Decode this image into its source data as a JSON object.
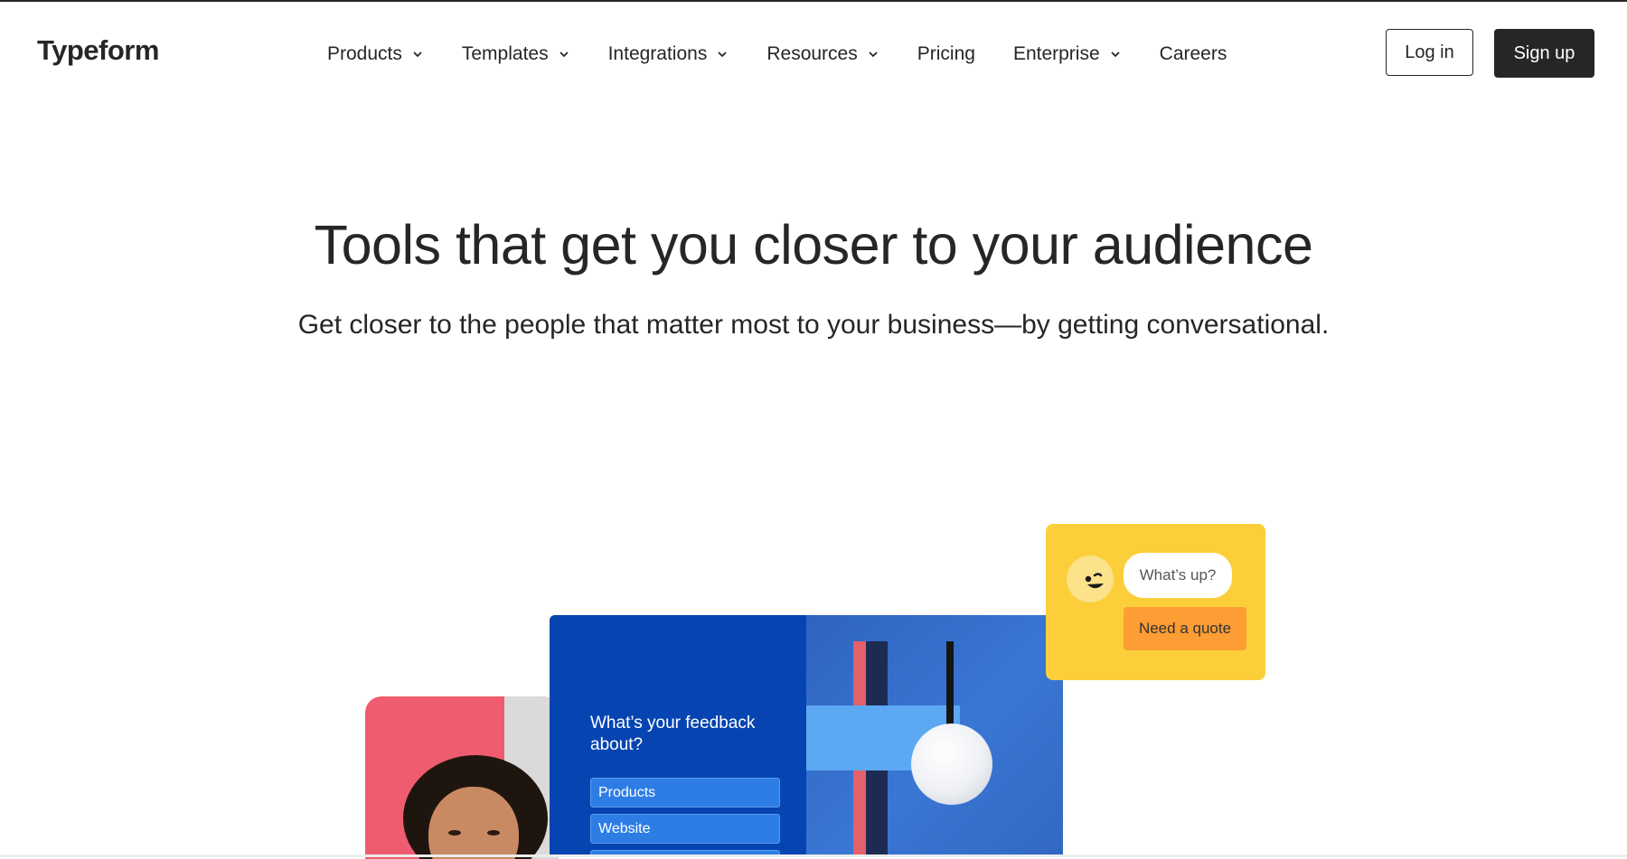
{
  "header": {
    "logo": "Typeform",
    "nav": [
      {
        "label": "Products",
        "has_dropdown": true,
        "icon": "chevron-down-icon"
      },
      {
        "label": "Templates",
        "has_dropdown": true,
        "icon": "chevron-down-icon"
      },
      {
        "label": "Integrations",
        "has_dropdown": true,
        "icon": "chevron-down-icon"
      },
      {
        "label": "Resources",
        "has_dropdown": true,
        "icon": "chevron-down-icon"
      },
      {
        "label": "Pricing",
        "has_dropdown": false
      },
      {
        "label": "Enterprise",
        "has_dropdown": true,
        "icon": "chevron-down-icon"
      },
      {
        "label": "Careers",
        "has_dropdown": false
      }
    ],
    "login_label": "Log in",
    "signup_label": "Sign up"
  },
  "hero": {
    "title": "Tools that get you closer to your audience",
    "subtitle": "Get closer to the people that matter most to your business—by getting conversational."
  },
  "illustration": {
    "form": {
      "question": "What’s your feedback about?",
      "options": [
        "Products",
        "Website"
      ]
    },
    "chat": {
      "avatar_icon": "smiley-face-icon",
      "bubble": "What’s up?",
      "button": "Need a quote"
    }
  },
  "colors": {
    "ink": "#262627",
    "form_blue": "#0645b1",
    "option_blue": "#2d7de5",
    "chat_yellow": "#fccf3a",
    "chat_orange": "#fd9d34",
    "person_pink": "#ef5c6f"
  }
}
